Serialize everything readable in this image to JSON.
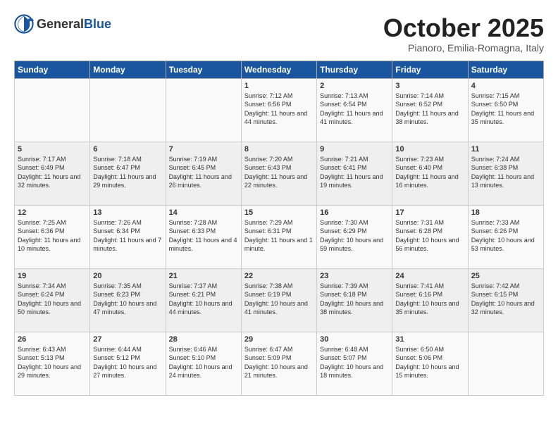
{
  "header": {
    "logo_general": "General",
    "logo_blue": "Blue",
    "title": "October 2025",
    "subtitle": "Pianoro, Emilia-Romagna, Italy"
  },
  "weekdays": [
    "Sunday",
    "Monday",
    "Tuesday",
    "Wednesday",
    "Thursday",
    "Friday",
    "Saturday"
  ],
  "weeks": [
    [
      {
        "day": "",
        "info": ""
      },
      {
        "day": "",
        "info": ""
      },
      {
        "day": "",
        "info": ""
      },
      {
        "day": "1",
        "info": "Sunrise: 7:12 AM\nSunset: 6:56 PM\nDaylight: 11 hours and 44 minutes."
      },
      {
        "day": "2",
        "info": "Sunrise: 7:13 AM\nSunset: 6:54 PM\nDaylight: 11 hours and 41 minutes."
      },
      {
        "day": "3",
        "info": "Sunrise: 7:14 AM\nSunset: 6:52 PM\nDaylight: 11 hours and 38 minutes."
      },
      {
        "day": "4",
        "info": "Sunrise: 7:15 AM\nSunset: 6:50 PM\nDaylight: 11 hours and 35 minutes."
      }
    ],
    [
      {
        "day": "5",
        "info": "Sunrise: 7:17 AM\nSunset: 6:49 PM\nDaylight: 11 hours and 32 minutes."
      },
      {
        "day": "6",
        "info": "Sunrise: 7:18 AM\nSunset: 6:47 PM\nDaylight: 11 hours and 29 minutes."
      },
      {
        "day": "7",
        "info": "Sunrise: 7:19 AM\nSunset: 6:45 PM\nDaylight: 11 hours and 26 minutes."
      },
      {
        "day": "8",
        "info": "Sunrise: 7:20 AM\nSunset: 6:43 PM\nDaylight: 11 hours and 22 minutes."
      },
      {
        "day": "9",
        "info": "Sunrise: 7:21 AM\nSunset: 6:41 PM\nDaylight: 11 hours and 19 minutes."
      },
      {
        "day": "10",
        "info": "Sunrise: 7:23 AM\nSunset: 6:40 PM\nDaylight: 11 hours and 16 minutes."
      },
      {
        "day": "11",
        "info": "Sunrise: 7:24 AM\nSunset: 6:38 PM\nDaylight: 11 hours and 13 minutes."
      }
    ],
    [
      {
        "day": "12",
        "info": "Sunrise: 7:25 AM\nSunset: 6:36 PM\nDaylight: 11 hours and 10 minutes."
      },
      {
        "day": "13",
        "info": "Sunrise: 7:26 AM\nSunset: 6:34 PM\nDaylight: 11 hours and 7 minutes."
      },
      {
        "day": "14",
        "info": "Sunrise: 7:28 AM\nSunset: 6:33 PM\nDaylight: 11 hours and 4 minutes."
      },
      {
        "day": "15",
        "info": "Sunrise: 7:29 AM\nSunset: 6:31 PM\nDaylight: 11 hours and 1 minute."
      },
      {
        "day": "16",
        "info": "Sunrise: 7:30 AM\nSunset: 6:29 PM\nDaylight: 10 hours and 59 minutes."
      },
      {
        "day": "17",
        "info": "Sunrise: 7:31 AM\nSunset: 6:28 PM\nDaylight: 10 hours and 56 minutes."
      },
      {
        "day": "18",
        "info": "Sunrise: 7:33 AM\nSunset: 6:26 PM\nDaylight: 10 hours and 53 minutes."
      }
    ],
    [
      {
        "day": "19",
        "info": "Sunrise: 7:34 AM\nSunset: 6:24 PM\nDaylight: 10 hours and 50 minutes."
      },
      {
        "day": "20",
        "info": "Sunrise: 7:35 AM\nSunset: 6:23 PM\nDaylight: 10 hours and 47 minutes."
      },
      {
        "day": "21",
        "info": "Sunrise: 7:37 AM\nSunset: 6:21 PM\nDaylight: 10 hours and 44 minutes."
      },
      {
        "day": "22",
        "info": "Sunrise: 7:38 AM\nSunset: 6:19 PM\nDaylight: 10 hours and 41 minutes."
      },
      {
        "day": "23",
        "info": "Sunrise: 7:39 AM\nSunset: 6:18 PM\nDaylight: 10 hours and 38 minutes."
      },
      {
        "day": "24",
        "info": "Sunrise: 7:41 AM\nSunset: 6:16 PM\nDaylight: 10 hours and 35 minutes."
      },
      {
        "day": "25",
        "info": "Sunrise: 7:42 AM\nSunset: 6:15 PM\nDaylight: 10 hours and 32 minutes."
      }
    ],
    [
      {
        "day": "26",
        "info": "Sunrise: 6:43 AM\nSunset: 5:13 PM\nDaylight: 10 hours and 29 minutes."
      },
      {
        "day": "27",
        "info": "Sunrise: 6:44 AM\nSunset: 5:12 PM\nDaylight: 10 hours and 27 minutes."
      },
      {
        "day": "28",
        "info": "Sunrise: 6:46 AM\nSunset: 5:10 PM\nDaylight: 10 hours and 24 minutes."
      },
      {
        "day": "29",
        "info": "Sunrise: 6:47 AM\nSunset: 5:09 PM\nDaylight: 10 hours and 21 minutes."
      },
      {
        "day": "30",
        "info": "Sunrise: 6:48 AM\nSunset: 5:07 PM\nDaylight: 10 hours and 18 minutes."
      },
      {
        "day": "31",
        "info": "Sunrise: 6:50 AM\nSunset: 5:06 PM\nDaylight: 10 hours and 15 minutes."
      },
      {
        "day": "",
        "info": ""
      }
    ]
  ]
}
